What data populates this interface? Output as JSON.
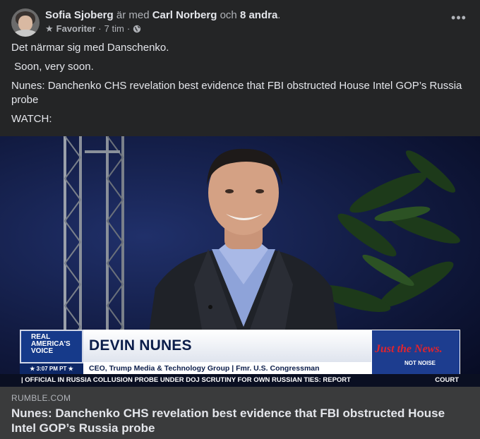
{
  "post": {
    "author": "Sofia Sjoberg",
    "with_text": "är med",
    "tagged": "Carl Norberg",
    "and_text": "och",
    "others": "8 andra",
    "period": ".",
    "audience_label": "Favoriter",
    "separator": "·",
    "time": "7 tim",
    "more_label": "•••",
    "icons": {
      "favorite": "star-icon",
      "audience": "globe-icon",
      "more": "more-options-icon"
    },
    "text_lines": [
      "Det närmar sig med Danschenko.",
      " Soon, very soon.",
      "Nunes: Danchenko CHS revelation best evidence that FBI obstructed House Intel GOP’s Russia probe",
      "WATCH:"
    ]
  },
  "video": {
    "chyron_logo": [
      "REAL",
      "AMERICA'S",
      "VOICE"
    ],
    "chyron_time": "★ 3:07 PM PT ★",
    "chyron_name": "DEVIN NUNES",
    "chyron_title": "CEO, Trump Media & Technology Group | Fmr. U.S. Congressman",
    "brand_main": "Just the News.",
    "brand_sub": "NOT NOISE",
    "ticker": "| OFFICIAL IN RUSSIA COLLUSION PROBE UNDER DOJ SCRUTINY FOR OWN RUSSIAN TIES: REPORT",
    "ticker_end": "COURT"
  },
  "link": {
    "domain": "RUMBLE.COM",
    "title": "Nunes: Danchenko CHS revelation best evidence that FBI obstructed House Intel GOP’s Russia probe"
  },
  "colors": {
    "background": "#242526",
    "text": "#e4e6eb",
    "muted": "#b0b3b8",
    "link_bg": "#3a3b3c"
  }
}
